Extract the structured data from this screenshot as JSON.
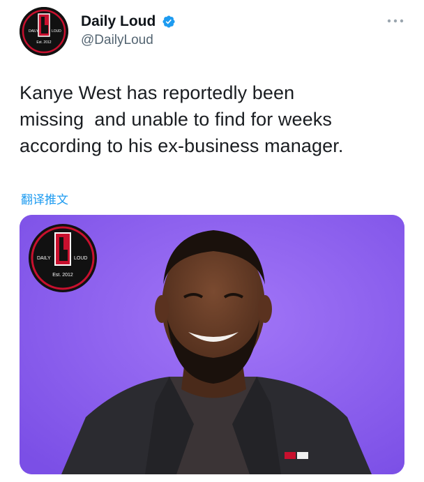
{
  "tweet": {
    "author": {
      "display_name": "Daily Loud",
      "handle": "@DailyLoud",
      "verified": true,
      "avatar_icon": "daily-loud-logo",
      "logo_text": {
        "left": "DAILY",
        "right": "LOUD",
        "est": "Est. 2012"
      }
    },
    "text": "Kanye West has reportedly been\nmissing  and unable to find for weeks\naccording to his ex-business manager.",
    "translate_label": "翻译推文",
    "menu_icon": "more-horizontal-icon",
    "media": {
      "logo_text": {
        "left": "DAILY",
        "right": "LOUD",
        "est": "Est. 2012"
      }
    }
  },
  "colors": {
    "link": "#1d9bf0",
    "verified": "#1d9bf0",
    "brand_red": "#c8102e",
    "media_background": "#8a5cf0"
  }
}
